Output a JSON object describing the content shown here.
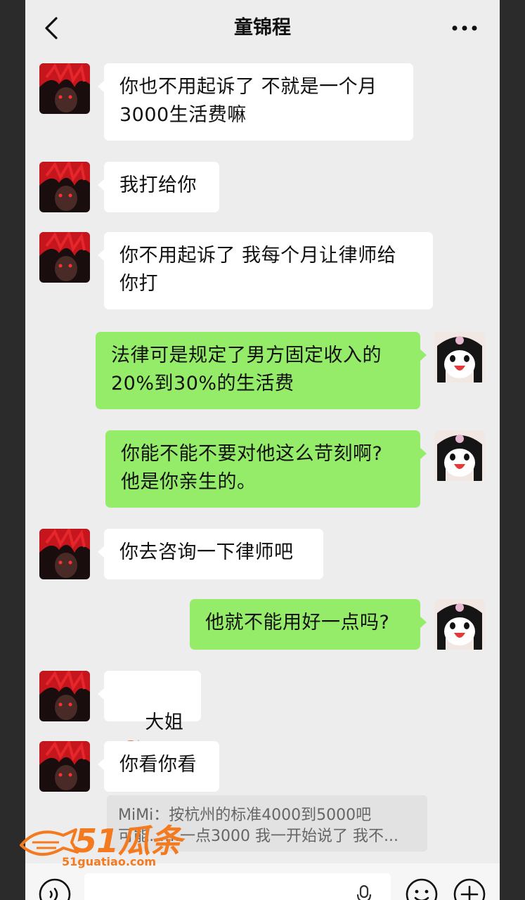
{
  "header": {
    "title": "童锦程"
  },
  "messages": [
    {
      "side": "left",
      "text": "你也不用起诉了 不就是一个月\n3000生活费嘛"
    },
    {
      "side": "left",
      "text": "我打给你"
    },
    {
      "side": "left",
      "text": "你不用起诉了 我每个月让律师给\n你打"
    },
    {
      "side": "right",
      "text": "法律可是规定了男方固定收入的\n20%到30%的生活费"
    },
    {
      "side": "right",
      "text": "你能不能不要对他这么苛刻啊?\n他是你亲生的。"
    },
    {
      "side": "left",
      "text": "你去咨询一下律师吧"
    },
    {
      "side": "right",
      "text": "他就不能用好一点吗?"
    },
    {
      "side": "left",
      "text": "大姐",
      "emoji": "angry-sweat-emoji"
    },
    {
      "side": "left",
      "text": "你看你看"
    }
  ],
  "quote": {
    "line1": "MiMi：按杭州的标准4000到5000吧",
    "line2": "可能……一点3000 我一开始说了 我不..."
  },
  "input_bar": {
    "icons": [
      "voice-icon",
      "microphone-icon",
      "emoji-icon",
      "plus-icon"
    ]
  },
  "watermark": {
    "text": "51瓜条",
    "url": "51guatiao.com"
  },
  "colors": {
    "background": "#ededed",
    "bubble_self": "#95ec69",
    "bubble_other": "#ffffff",
    "watermark": "#f47a1f"
  }
}
